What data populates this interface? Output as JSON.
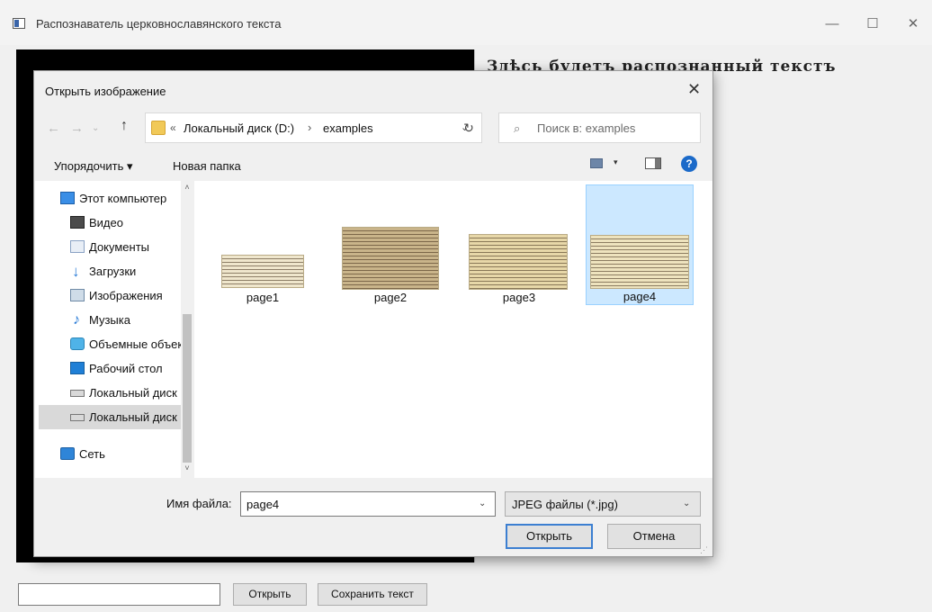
{
  "window": {
    "title": "Распознаватель церковнославянского текста",
    "minimize": "—",
    "maximize": "☐",
    "close": "✕"
  },
  "main": {
    "result_text": "Здѣсь будетъ распознанный текстъ",
    "path_input_value": "",
    "open_button": "Открыть",
    "save_button": "Сохранить текст"
  },
  "dialog": {
    "title": "Открыть изображение",
    "close": "✕",
    "nav": {
      "back": "←",
      "forward": "→",
      "recent": "⌄",
      "up": "↑"
    },
    "address": {
      "overflow": "«",
      "crumbs": [
        "Локальный диск (D:)",
        "examples"
      ],
      "separator": "›",
      "dropdown": "⌄"
    },
    "refresh": "↻",
    "search_placeholder": "Поиск в: examples",
    "toolbar": {
      "organize": "Упорядочить ▾",
      "new_folder": "Новая папка",
      "view_arrow": "▾",
      "help": "?"
    },
    "nav_pane": [
      {
        "label": "Этот компьютер",
        "icon": "computer-icon"
      },
      {
        "label": "Видео",
        "icon": "video-folder-icon"
      },
      {
        "label": "Документы",
        "icon": "documents-folder-icon"
      },
      {
        "label": "Загрузки",
        "icon": "downloads-folder-icon"
      },
      {
        "label": "Изображения",
        "icon": "pictures-folder-icon"
      },
      {
        "label": "Музыка",
        "icon": "music-folder-icon"
      },
      {
        "label": "Объемные объекты",
        "icon": "3d-objects-folder-icon"
      },
      {
        "label": "Рабочий стол",
        "icon": "desktop-folder-icon"
      },
      {
        "label": "Локальный диск (C:)",
        "icon": "local-disk-c-icon"
      },
      {
        "label": "Локальный диск (D:)",
        "icon": "local-disk-d-icon",
        "selected": true
      },
      {
        "label": "Сеть",
        "icon": "network-icon"
      }
    ],
    "scroll": {
      "up": "˄",
      "down": "˅"
    },
    "files": [
      {
        "name": "page1",
        "thumb_color": "#efe6cc"
      },
      {
        "name": "page2",
        "thumb_color": "#c9b48a"
      },
      {
        "name": "page3",
        "thumb_color": "#e7d7a8"
      },
      {
        "name": "page4",
        "thumb_color": "#eee3be",
        "selected": true
      }
    ],
    "filename_label": "Имя файла:",
    "filename_value": "page4",
    "filter_value": "JPEG файлы (*.jpg)",
    "dropdown_glyph": "⌄",
    "open_button": "Открыть",
    "cancel_button": "Отмена",
    "grip": "⋰"
  },
  "colors": {
    "accent": "#3c7fd1",
    "selection": "#cce8ff",
    "image_panel": "#000000"
  }
}
